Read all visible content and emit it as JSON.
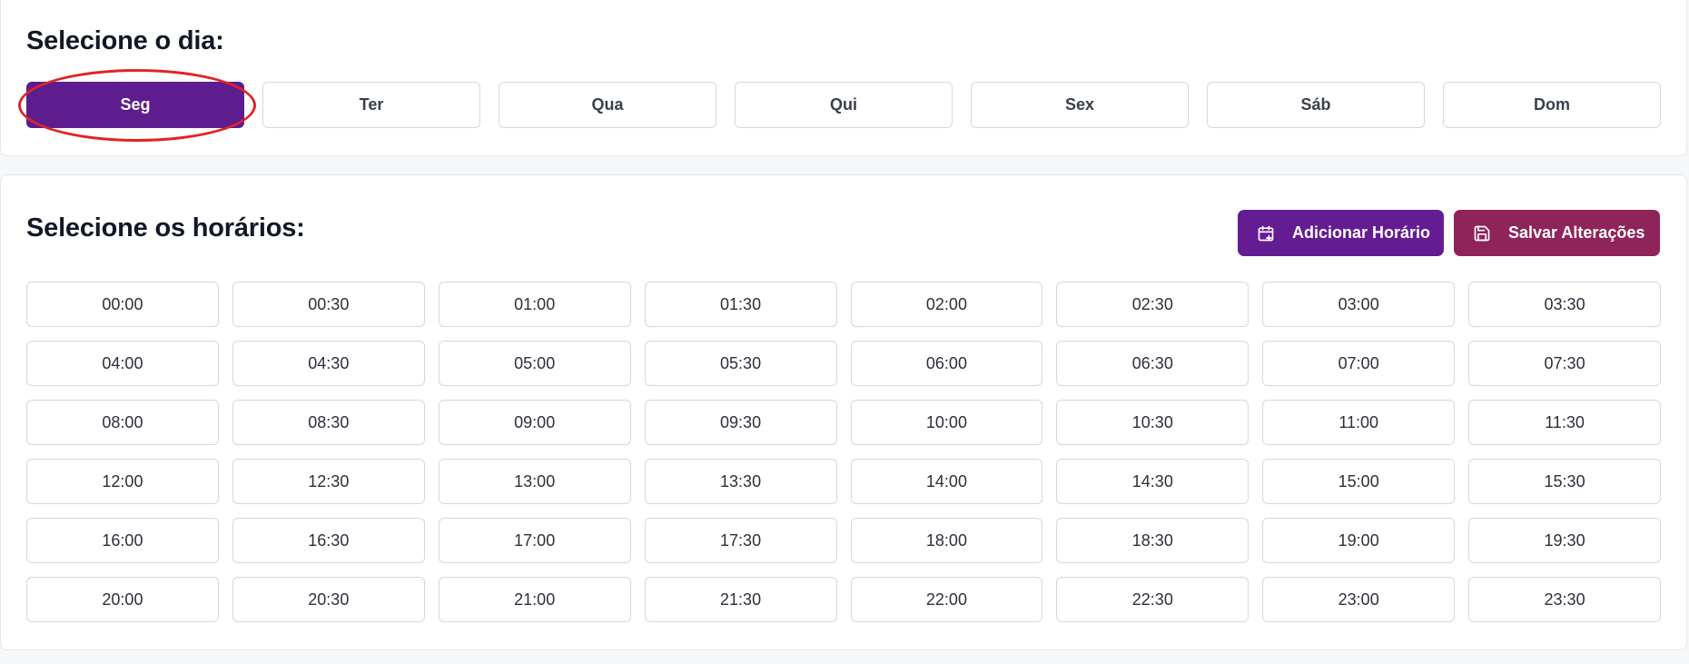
{
  "day_section": {
    "title": "Selecione o dia:",
    "selected": "Seg",
    "days": [
      "Seg",
      "Ter",
      "Qua",
      "Qui",
      "Sex",
      "Sáb",
      "Dom"
    ]
  },
  "time_section": {
    "title": "Selecione os horários:",
    "add_button_label": "Adicionar Horário",
    "add_button_icon": "calendar-plus-icon",
    "save_button_label": "Salvar Alterações",
    "save_button_icon": "save-icon",
    "slots": [
      "00:00",
      "00:30",
      "01:00",
      "01:30",
      "02:00",
      "02:30",
      "03:00",
      "03:30",
      "04:00",
      "04:30",
      "05:00",
      "05:30",
      "06:00",
      "06:30",
      "07:00",
      "07:30",
      "08:00",
      "08:30",
      "09:00",
      "09:30",
      "10:00",
      "10:30",
      "11:00",
      "11:30",
      "12:00",
      "12:30",
      "13:00",
      "13:30",
      "14:00",
      "14:30",
      "15:00",
      "15:30",
      "16:00",
      "16:30",
      "17:00",
      "17:30",
      "18:00",
      "18:30",
      "19:00",
      "19:30",
      "20:00",
      "20:30",
      "21:00",
      "21:30",
      "22:00",
      "22:30",
      "23:00",
      "23:30"
    ]
  },
  "colors": {
    "accent_purple": "#5e1d8f",
    "add_button": "#641c93",
    "save_button": "#8e2459",
    "highlight_ring": "#e02424"
  }
}
